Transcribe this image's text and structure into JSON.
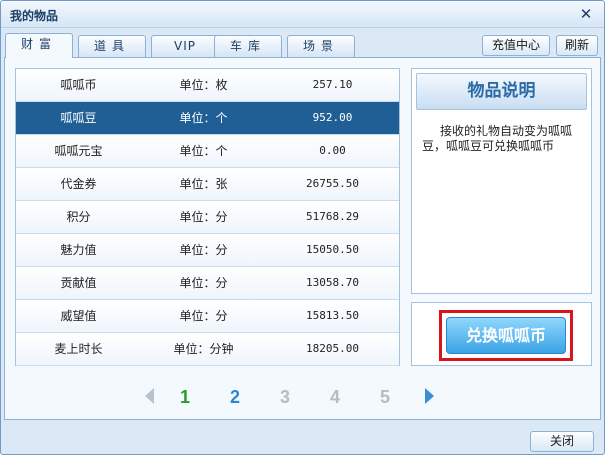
{
  "window": {
    "title": "我的物品"
  },
  "tabs": [
    {
      "label": "财富",
      "active": true
    },
    {
      "label": "道具",
      "active": false
    },
    {
      "label": "VIP",
      "active": false
    },
    {
      "label": "车库",
      "active": false
    },
    {
      "label": "场景",
      "active": false
    }
  ],
  "toolbar": {
    "recharge_label": "充值中心",
    "refresh_label": "刷新"
  },
  "items": [
    {
      "name": "呱呱币",
      "unit": "单位：枚",
      "value": "257.10",
      "selected": false
    },
    {
      "name": "呱呱豆",
      "unit": "单位：个",
      "value": "952.00",
      "selected": true
    },
    {
      "name": "呱呱元宝",
      "unit": "单位：个",
      "value": "0.00",
      "selected": false
    },
    {
      "name": "代金券",
      "unit": "单位：张",
      "value": "26755.50",
      "selected": false
    },
    {
      "name": "积分",
      "unit": "单位：分",
      "value": "51768.29",
      "selected": false
    },
    {
      "name": "魅力值",
      "unit": "单位：分",
      "value": "15050.50",
      "selected": false
    },
    {
      "name": "贡献值",
      "unit": "单位：分",
      "value": "13058.70",
      "selected": false
    },
    {
      "name": "威望值",
      "unit": "单位：分",
      "value": "15813.50",
      "selected": false
    },
    {
      "name": "麦上时长",
      "unit": "单位：分钟",
      "value": "18205.00",
      "selected": false
    }
  ],
  "description": {
    "header": "物品说明",
    "text": "接收的礼物自动变为呱呱豆，呱呱豆可兑换呱呱币"
  },
  "exchange": {
    "label": "兑换呱呱币"
  },
  "pagination": {
    "pages": [
      "1",
      "2",
      "3",
      "4",
      "5"
    ],
    "current": "1",
    "colors": {
      "current": "#2a9a2a",
      "active": "#2f86cf",
      "disabled": "#b4bcc4"
    }
  },
  "footer": {
    "close_label": "关闭"
  }
}
